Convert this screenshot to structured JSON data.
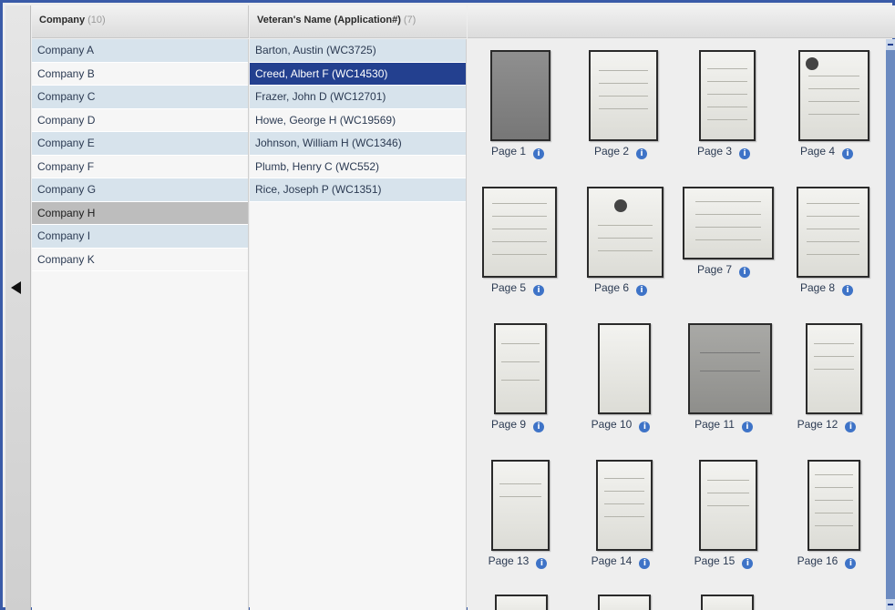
{
  "company_panel": {
    "header": "Company",
    "count": "(10)",
    "items": [
      {
        "label": "Company A"
      },
      {
        "label": "Company B"
      },
      {
        "label": "Company C"
      },
      {
        "label": "Company D"
      },
      {
        "label": "Company E"
      },
      {
        "label": "Company F"
      },
      {
        "label": "Company G"
      },
      {
        "label": "Company H"
      },
      {
        "label": "Company I"
      },
      {
        "label": "Company K"
      }
    ],
    "selected": "Company H"
  },
  "veteran_panel": {
    "header": "Veteran's Name (Application#)",
    "count": "(7)",
    "items": [
      {
        "label": "Barton, Austin (WC3725)"
      },
      {
        "label": "Creed, Albert F (WC14530)"
      },
      {
        "label": "Frazer, John D (WC12701)"
      },
      {
        "label": "Howe, George H (WC19569)"
      },
      {
        "label": "Johnson, William H (WC1346)"
      },
      {
        "label": "Plumb, Henry C (WC552)"
      },
      {
        "label": "Rice, Joseph P (WC1351)"
      }
    ],
    "selected": "Creed, Albert F (WC14530)"
  },
  "thumbnails": {
    "info_glyph": "i",
    "pages": [
      {
        "label": "Page 1"
      },
      {
        "label": "Page 2"
      },
      {
        "label": "Page 3"
      },
      {
        "label": "Page 4"
      },
      {
        "label": "Page 5"
      },
      {
        "label": "Page 6"
      },
      {
        "label": "Page 7"
      },
      {
        "label": "Page 8"
      },
      {
        "label": "Page 9"
      },
      {
        "label": "Page 10"
      },
      {
        "label": "Page 11"
      },
      {
        "label": "Page 12"
      },
      {
        "label": "Page 13"
      },
      {
        "label": "Page 14"
      },
      {
        "label": "Page 15"
      },
      {
        "label": "Page 16"
      }
    ]
  },
  "icons": {
    "collapse": "triangle-left-icon",
    "info": "info-icon"
  },
  "colors": {
    "frame": "#3a5ba8",
    "selected_row": "#23408f",
    "alt_row": "#d7e3ec",
    "info_badge": "#3e73c7"
  }
}
